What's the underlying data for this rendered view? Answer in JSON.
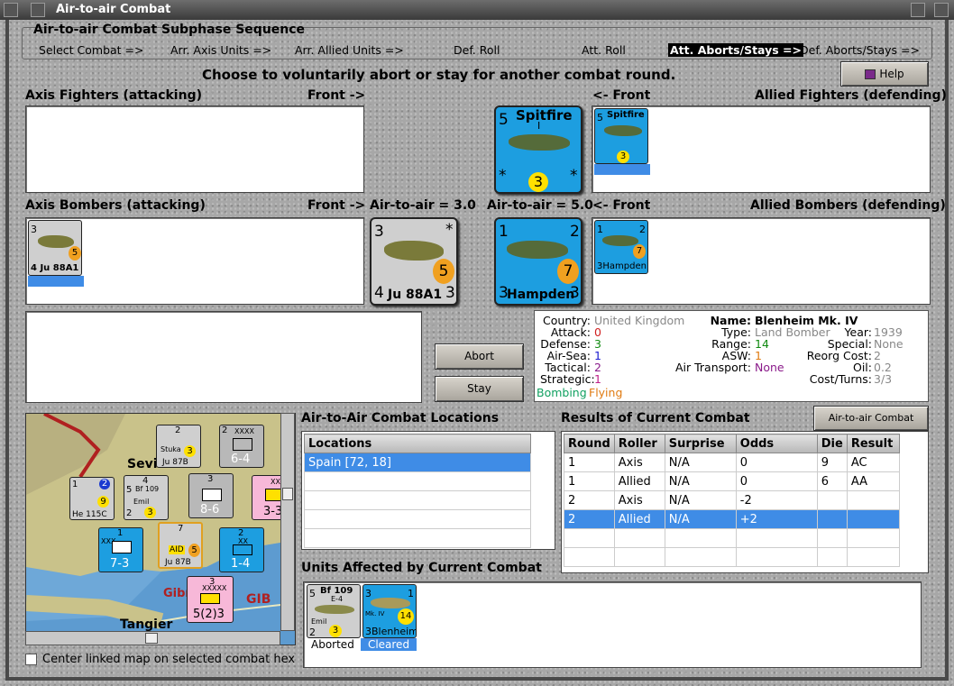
{
  "window": {
    "title": "Air-to-air Combat"
  },
  "sequence": {
    "title": "Air-to-air Combat Subphase Sequence",
    "steps": [
      "Select Combat =>",
      "Arr. Axis Units =>",
      "Arr. Allied Units =>",
      "Def. Roll",
      "Att. Roll",
      "Att. Aborts/Stays =>",
      "Def. Aborts/Stays =>"
    ],
    "active_index": 5
  },
  "instruction": "Choose to voluntarily abort or stay for another combat round.",
  "help_button": "Help",
  "sections": {
    "axis_fighters": "Axis Fighters (attacking)",
    "allied_fighters": "Allied Fighters (defending)",
    "axis_bombers": "Axis Bombers (attacking)",
    "allied_bombers": "Allied Bombers (defending)",
    "front_right": "Front ->",
    "front_left": "<- Front",
    "axis_a2a": "Air-to-air = 3.0",
    "allied_a2a": "Air-to-air = 5.0"
  },
  "counters": {
    "spitfire": {
      "name": "Spitfire",
      "tl": "5",
      "num": "3",
      "star": "*",
      "sub": "I",
      "color": "#1d9ee0"
    },
    "ju88": {
      "name": "Ju 88A1",
      "tl": "3",
      "tr": "*",
      "bl": "4",
      "br": "3",
      "num": "5",
      "color": "#cfcfcf"
    },
    "hampden": {
      "name": "Hampden",
      "tl": "1",
      "tr": "2",
      "bl": "3",
      "br": "3",
      "num": "7",
      "color": "#1d9ee0"
    }
  },
  "buttons": {
    "abort": "Abort",
    "stay": "Stay",
    "chart": "Air-to-air Combat Chart"
  },
  "unit_info": {
    "country_k": "Country:",
    "country": "United Kingdom",
    "attack_k": "Attack:",
    "attack": "0",
    "defense_k": "Defense:",
    "defense": "3",
    "airsea_k": "Air-Sea:",
    "airsea": "1",
    "tactical_k": "Tactical:",
    "tactical": "2",
    "strategic_k": "Strategic:",
    "strategic": "1",
    "role1": "Bombing",
    "role2": "Flying",
    "name_k": "Name:",
    "name": "Blenheim Mk. IV",
    "type_k": "Type:",
    "type": "Land Bomber",
    "year_k": "Year:",
    "year": "1939",
    "range_k": "Range:",
    "range": "14",
    "special_k": "Special:",
    "special": "None",
    "asw_k": "ASW:",
    "asw": "1",
    "reorg_k": "Reorg Cost:",
    "reorg": "2",
    "transport_k": "Air Transport:",
    "transport": "None",
    "oil_k": "Oil:",
    "oil": "0.2",
    "cost_k": "Cost/Turns:",
    "cost": "3/3"
  },
  "locations": {
    "title": "Air-to-Air Combat Locations",
    "header": "Locations",
    "rows": [
      "Spain [72, 18]"
    ]
  },
  "results": {
    "title": "Results of Current Combat",
    "headers": [
      "Round",
      "Roller",
      "Surprise",
      "Odds",
      "Die",
      "Result"
    ],
    "rows": [
      [
        "1",
        "Axis",
        "N/A",
        "0",
        "9",
        "AC"
      ],
      [
        "1",
        "Allied",
        "N/A",
        "0",
        "6",
        "AA"
      ],
      [
        "2",
        "Axis",
        "N/A",
        "-2",
        "",
        ""
      ],
      [
        "2",
        "Allied",
        "N/A",
        "+2",
        "",
        ""
      ]
    ]
  },
  "affected": {
    "title": "Units Affected by Current Combat",
    "units": [
      {
        "name": "Bf 109",
        "sub": "E-4",
        "pilot": "Emil",
        "tl": "5",
        "bl": "2",
        "num": "3",
        "status": "Aborted"
      },
      {
        "name": "Blenheim",
        "sub": "Mk. IV",
        "tl": "3",
        "tr": "1",
        "bl": "3",
        "num": "14",
        "status": "Cleared"
      }
    ]
  },
  "map": {
    "labels": [
      "Sevil",
      "Gibr",
      "GIB",
      "Tangier"
    ],
    "center_checkbox": "Center linked map on selected combat hex",
    "units": [
      {
        "id": "stuka",
        "top": "2",
        "name": "Ju 87B",
        "sub": "Stuka",
        "num": "3"
      },
      {
        "id": "inf1",
        "top": "2",
        "big": "6-4",
        "sub": "XXXX"
      },
      {
        "id": "he115",
        "tl": "1",
        "num": "9",
        "name": "He 115C",
        "badge": "2"
      },
      {
        "id": "bf109m",
        "top": "4",
        "name": "Bf 109",
        "sub": "Emil",
        "num": "3",
        "tl": "5",
        "bl": "2"
      },
      {
        "id": "inf2",
        "top": "3",
        "big": "8-6"
      },
      {
        "id": "inf3",
        "big": "3-3",
        "sub": "XXX"
      },
      {
        "id": "inf4",
        "top": "1",
        "big": "7-3",
        "sub": "XXX"
      },
      {
        "id": "ju87m",
        "top": "7",
        "name": "Ju 87B",
        "num": "5",
        "tag": "AID"
      },
      {
        "id": "inf5",
        "top": "2",
        "big": "1-4",
        "sub": "XX"
      },
      {
        "id": "spa",
        "top": "3",
        "big": "5(2)3",
        "sub": "XXXXX"
      }
    ]
  }
}
